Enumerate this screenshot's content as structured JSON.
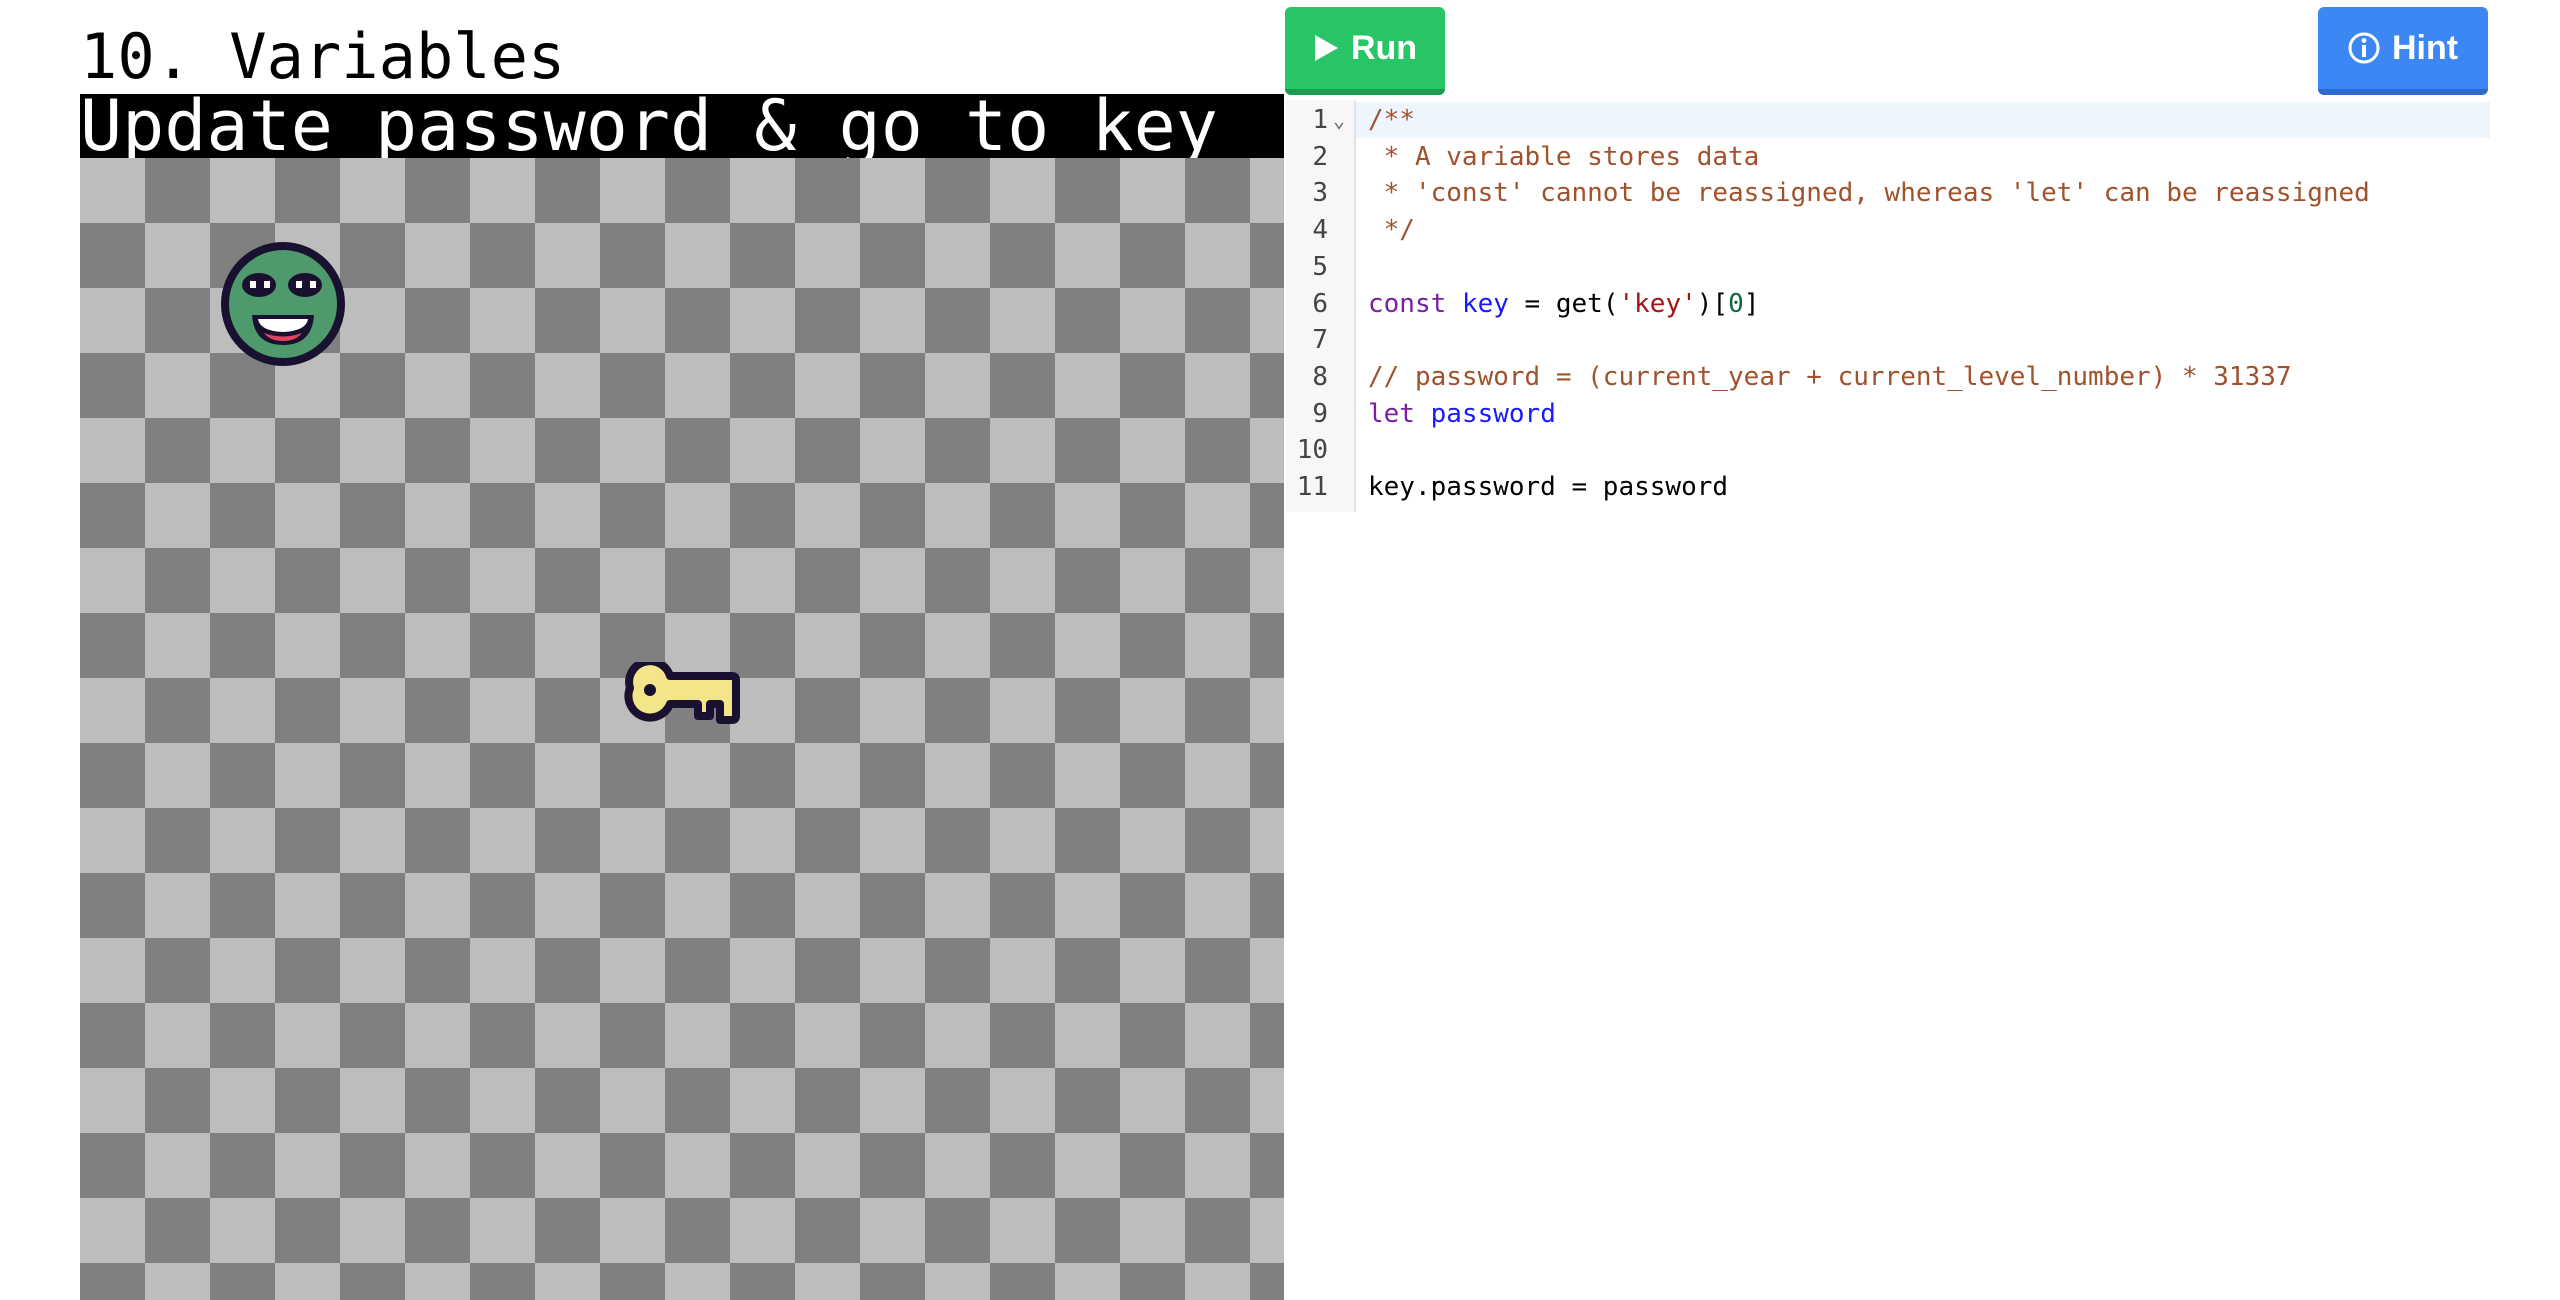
{
  "level": {
    "title": "10. Variables",
    "objective": "Update password & go to key"
  },
  "toolbar": {
    "run_label": "Run",
    "run_icon": "play-icon",
    "hint_label": "Hint",
    "hint_icon": "info-icon",
    "colors": {
      "run": "#27c565",
      "hint": "#3d87f5"
    }
  },
  "board": {
    "colors": {
      "light": "#bdbdbd",
      "dark": "#808080"
    },
    "sprites": [
      {
        "name": "player",
        "icon": "green-smiley-face"
      },
      {
        "name": "key",
        "icon": "yellow-key"
      }
    ]
  },
  "editor": {
    "line_numbers": [
      "1",
      "2",
      "3",
      "4",
      "5",
      "6",
      "7",
      "8",
      "9",
      "10",
      "11"
    ],
    "lines": [
      [
        {
          "t": "/**",
          "c": "comment"
        }
      ],
      [
        {
          "t": " * A variable stores data",
          "c": "comment"
        }
      ],
      [
        {
          "t": " * 'const' cannot be reassigned, whereas 'let' can be reassigned",
          "c": "comment"
        }
      ],
      [
        {
          "t": " */",
          "c": "comment"
        }
      ],
      [],
      [
        {
          "t": "const",
          "c": "kw"
        },
        {
          "t": " ",
          "c": ""
        },
        {
          "t": "key",
          "c": "def"
        },
        {
          "t": " = get(",
          "c": ""
        },
        {
          "t": "'key'",
          "c": "str"
        },
        {
          "t": ")[",
          "c": ""
        },
        {
          "t": "0",
          "c": "num"
        },
        {
          "t": "]",
          "c": ""
        }
      ],
      [],
      [
        {
          "t": "// password = (current_year + current_level_number) * 31337",
          "c": "comment"
        }
      ],
      [
        {
          "t": "let",
          "c": "kw"
        },
        {
          "t": " ",
          "c": ""
        },
        {
          "t": "password",
          "c": "def"
        }
      ],
      [],
      [
        {
          "t": "key.password = password",
          "c": ""
        }
      ]
    ]
  }
}
